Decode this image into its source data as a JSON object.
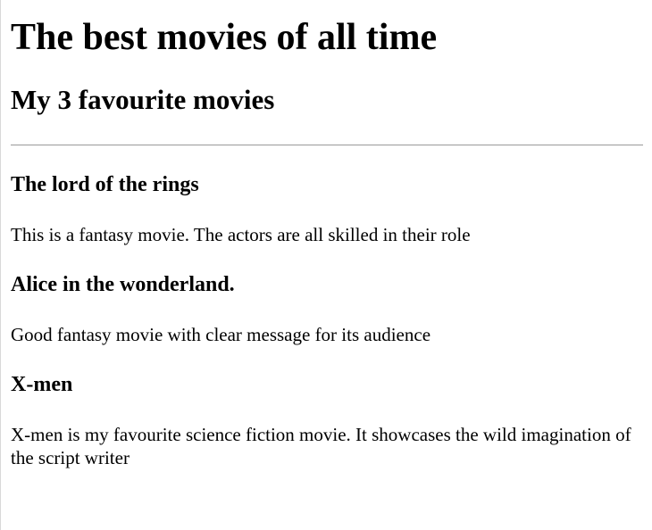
{
  "page": {
    "title": "The best movies of all time",
    "subtitle": "My 3 favourite movies"
  },
  "movies": [
    {
      "title": "The lord of the rings",
      "description": "This is a fantasy movie. The actors are all skilled in their role"
    },
    {
      "title": "Alice in the wonderland.",
      "description": "Good fantasy movie with clear message for its audience"
    },
    {
      "title": "X-men",
      "description": "X-men is my favourite science fiction movie. It showcases the wild imagination of the script writer"
    }
  ]
}
